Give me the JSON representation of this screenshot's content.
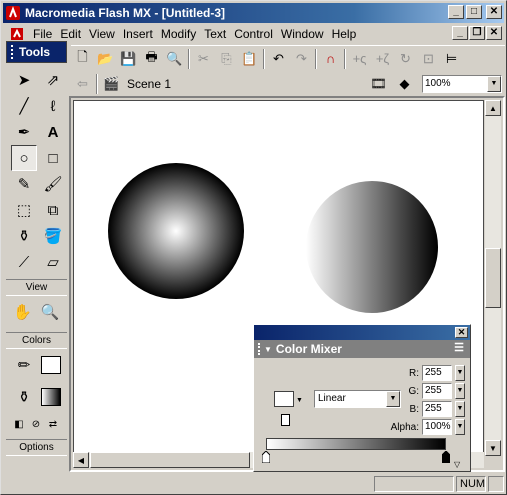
{
  "window": {
    "title": "Macromedia Flash MX - [Untitled-3]"
  },
  "menu": [
    {
      "label": "File",
      "key": "F"
    },
    {
      "label": "Edit",
      "key": "E"
    },
    {
      "label": "View",
      "key": "V"
    },
    {
      "label": "Insert",
      "key": "I"
    },
    {
      "label": "Modify",
      "key": "M"
    },
    {
      "label": "Text",
      "key": "T"
    },
    {
      "label": "Control",
      "key": "C"
    },
    {
      "label": "Window",
      "key": "W"
    },
    {
      "label": "Help",
      "key": "H"
    }
  ],
  "toolbar": {
    "icons": [
      "new-file-icon",
      "open-icon",
      "save-icon",
      "print-icon",
      "print-preview-icon",
      "cut-icon",
      "copy-icon",
      "paste-icon",
      "undo-icon",
      "redo-icon",
      "snap-magnet-icon",
      "smooth-icon",
      "straighten-icon",
      "rotate-icon",
      "scale-icon",
      "align-icon"
    ]
  },
  "timeline": {
    "scene_label": "Scene 1",
    "zoom": "100%"
  },
  "tools": {
    "header": "Tools",
    "view_label": "View",
    "colors_label": "Colors",
    "options_label": "Options",
    "active": "oval-tool"
  },
  "color_mixer": {
    "title": "Color Mixer",
    "fill_type": "Linear",
    "r_label": "R:",
    "g_label": "G:",
    "b_label": "B:",
    "alpha_label": "Alpha:",
    "r": "255",
    "g": "255",
    "b": "255",
    "alpha": "100%"
  },
  "status": {
    "num": "NUM"
  },
  "colors": {
    "title_start": "#0a246a",
    "title_end": "#a6caf0",
    "stage": "#ffffff"
  }
}
